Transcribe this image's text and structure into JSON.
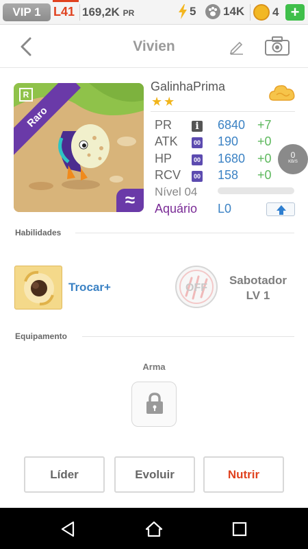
{
  "status_bar": {
    "vip": "VIP 1",
    "level": "L41",
    "pr_amount": "169,2K",
    "pr_unit": "PR",
    "energy": "5",
    "food": "14K",
    "coins": "4",
    "plus": "+"
  },
  "header": {
    "title": "Vivien"
  },
  "card": {
    "rarity": "Raro",
    "rarity_badge": "R",
    "element_symbol": "≈"
  },
  "pet": {
    "species": "GalinhaPrima",
    "stars": "★★",
    "stats": [
      {
        "label": "PR",
        "chip": "i",
        "value": "6840",
        "bonus": "+7"
      },
      {
        "label": "ATK",
        "chip": "00",
        "value": "190",
        "bonus": "+0"
      },
      {
        "label": "HP",
        "chip": "00",
        "value": "1680",
        "bonus": "+0"
      },
      {
        "label": "RCV",
        "chip": "00",
        "value": "158",
        "bonus": "+0"
      }
    ],
    "level_label": "Nível 04",
    "xp_progress": 0.0,
    "aquarium_label": "Aquário",
    "aquarium_value": "L0"
  },
  "speed_widget": {
    "value": "0",
    "unit": "KB/S"
  },
  "skills": {
    "heading": "Habilidades",
    "skill1_name": "Trocar+",
    "skill2_state": "OFF",
    "skill2_name": "Sabotador",
    "skill2_level": "LV 1"
  },
  "equipment": {
    "heading": "Equipamento",
    "weapon_label": "Arma"
  },
  "actions": {
    "leader": "Líder",
    "evolve": "Evoluir",
    "feed": "Nutrir"
  },
  "colors": {
    "accent_red": "#e0421f",
    "stat_blue": "#3b82c4",
    "bonus_green": "#5cb85c",
    "rarity_purple": "#6a3aa8",
    "aquarium_purple": "#7a2b96"
  }
}
